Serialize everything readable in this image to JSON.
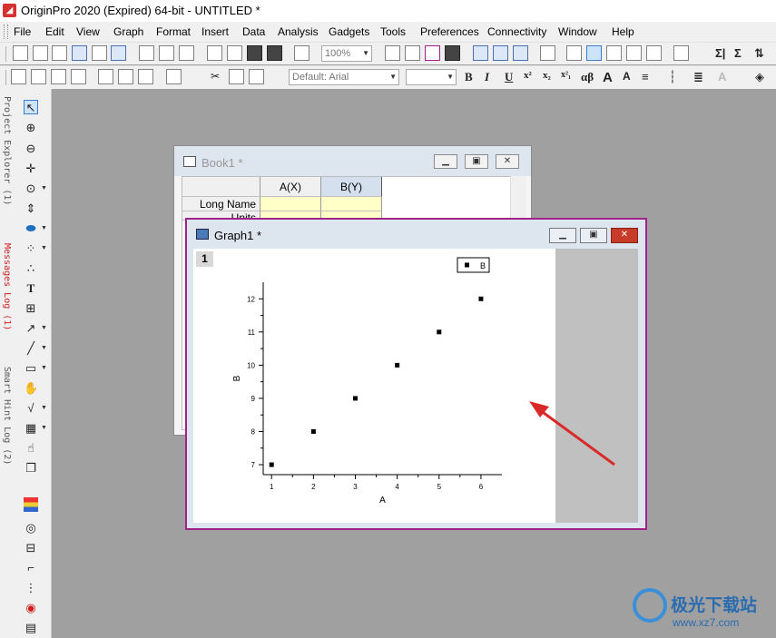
{
  "app": {
    "title": "OriginPro 2020 (Expired) 64-bit - UNTITLED *"
  },
  "menu": [
    "File",
    "Edit",
    "View",
    "Graph",
    "Format",
    "Insert",
    "Data",
    "Analysis",
    "Gadgets",
    "Tools",
    "Preferences",
    "Connectivity",
    "Window",
    "Help"
  ],
  "toolbar": {
    "zoom_value": "100%",
    "font_name": "Default: Arial",
    "font_size": "",
    "format_buttons": [
      "B",
      "I",
      "U",
      "x²",
      "x₂",
      "x²₁",
      "αβ",
      "A",
      "A"
    ]
  },
  "side_tabs": [
    {
      "label": "Project Explorer (1)",
      "color": "#555555"
    },
    {
      "label": "Messages Log (1)",
      "color": "#d02020"
    },
    {
      "label": "Smart Hint Log (2)",
      "color": "#555555"
    }
  ],
  "book": {
    "title": "Book1 *",
    "columns": [
      "A(X)",
      "B(Y)"
    ],
    "row_headers": [
      "Long Name",
      "Units"
    ]
  },
  "graph": {
    "title": "Graph1 *",
    "layer_number": "1",
    "window_buttons": [
      "minimize",
      "restore",
      "close"
    ]
  },
  "chart_data": {
    "type": "scatter",
    "title": "",
    "xlabel": "A",
    "ylabel": "B",
    "x": [
      1,
      2,
      3,
      4,
      5,
      6
    ],
    "series": [
      {
        "name": "B",
        "values": [
          7,
          8,
          9,
          10,
          11,
          12
        ]
      }
    ],
    "xticks": [
      "1",
      "2",
      "3",
      "4",
      "5",
      "6"
    ],
    "yticks": [
      "7",
      "8",
      "9",
      "10",
      "11",
      "12"
    ],
    "xlim": [
      0.8,
      6.5
    ],
    "ylim": [
      6.7,
      12.5
    ],
    "legend": "top-right",
    "grid": false,
    "marker_color": "#000000"
  },
  "annotation": {
    "arrow_color": "#d92a2a"
  },
  "watermark": {
    "name": "极光下载站",
    "url": "www.xz7.com"
  }
}
